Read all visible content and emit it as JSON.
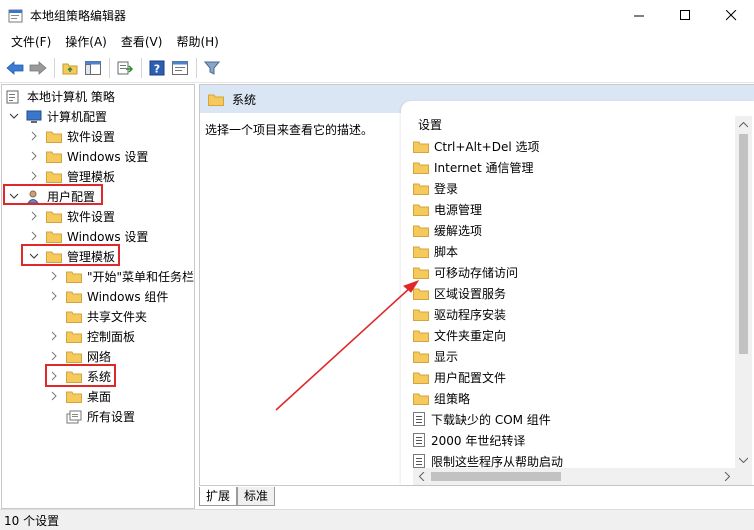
{
  "window": {
    "title": "本地组策略编辑器"
  },
  "menu": [
    {
      "label": "文件(F)"
    },
    {
      "label": "操作(A)"
    },
    {
      "label": "查看(V)"
    },
    {
      "label": "帮助(H)"
    }
  ],
  "tree": [
    {
      "label": "本地计算机 策略",
      "icon": "policy-icon"
    },
    {
      "label": "计算机配置",
      "icon": "computer-icon"
    },
    {
      "label": "软件设置"
    },
    {
      "label": "Windows 设置"
    },
    {
      "label": "管理模板"
    },
    {
      "label": "用户配置",
      "icon": "user-icon"
    },
    {
      "label": "软件设置"
    },
    {
      "label": "Windows 设置"
    },
    {
      "label": "管理模板"
    },
    {
      "label": "\"开始\"菜单和任务栏"
    },
    {
      "label": "Windows 组件"
    },
    {
      "label": "共享文件夹"
    },
    {
      "label": "控制面板"
    },
    {
      "label": "网络"
    },
    {
      "label": "系统"
    },
    {
      "label": "桌面"
    },
    {
      "label": "所有设置"
    }
  ],
  "right_pane": {
    "header": "系统",
    "description": "选择一个项目来查看它的描述。"
  },
  "settings_list": {
    "column_header": "设置",
    "items": [
      {
        "label": "Ctrl+Alt+Del 选项",
        "type": "folder"
      },
      {
        "label": "Internet 通信管理",
        "type": "folder"
      },
      {
        "label": "登录",
        "type": "folder"
      },
      {
        "label": "电源管理",
        "type": "folder"
      },
      {
        "label": "缓解选项",
        "type": "folder"
      },
      {
        "label": "脚本",
        "type": "folder"
      },
      {
        "label": "可移动存储访问",
        "type": "folder"
      },
      {
        "label": "区域设置服务",
        "type": "folder"
      },
      {
        "label": "驱动程序安装",
        "type": "folder"
      },
      {
        "label": "文件夹重定向",
        "type": "folder"
      },
      {
        "label": "显示",
        "type": "folder"
      },
      {
        "label": "用户配置文件",
        "type": "folder"
      },
      {
        "label": "组策略",
        "type": "folder"
      },
      {
        "label": "下载缺少的 COM 组件",
        "type": "setting"
      },
      {
        "label": "2000 年世纪转译",
        "type": "setting"
      },
      {
        "label": "限制这些程序从帮助启动",
        "type": "setting"
      }
    ]
  },
  "tabs": [
    {
      "label": "扩展"
    },
    {
      "label": "标准"
    }
  ],
  "status": {
    "text": "10 个设置"
  },
  "colors": {
    "annotation_red": "#e0282a",
    "folder_yellow": "#f5c95c",
    "header_blue": "#dbe6f4"
  }
}
